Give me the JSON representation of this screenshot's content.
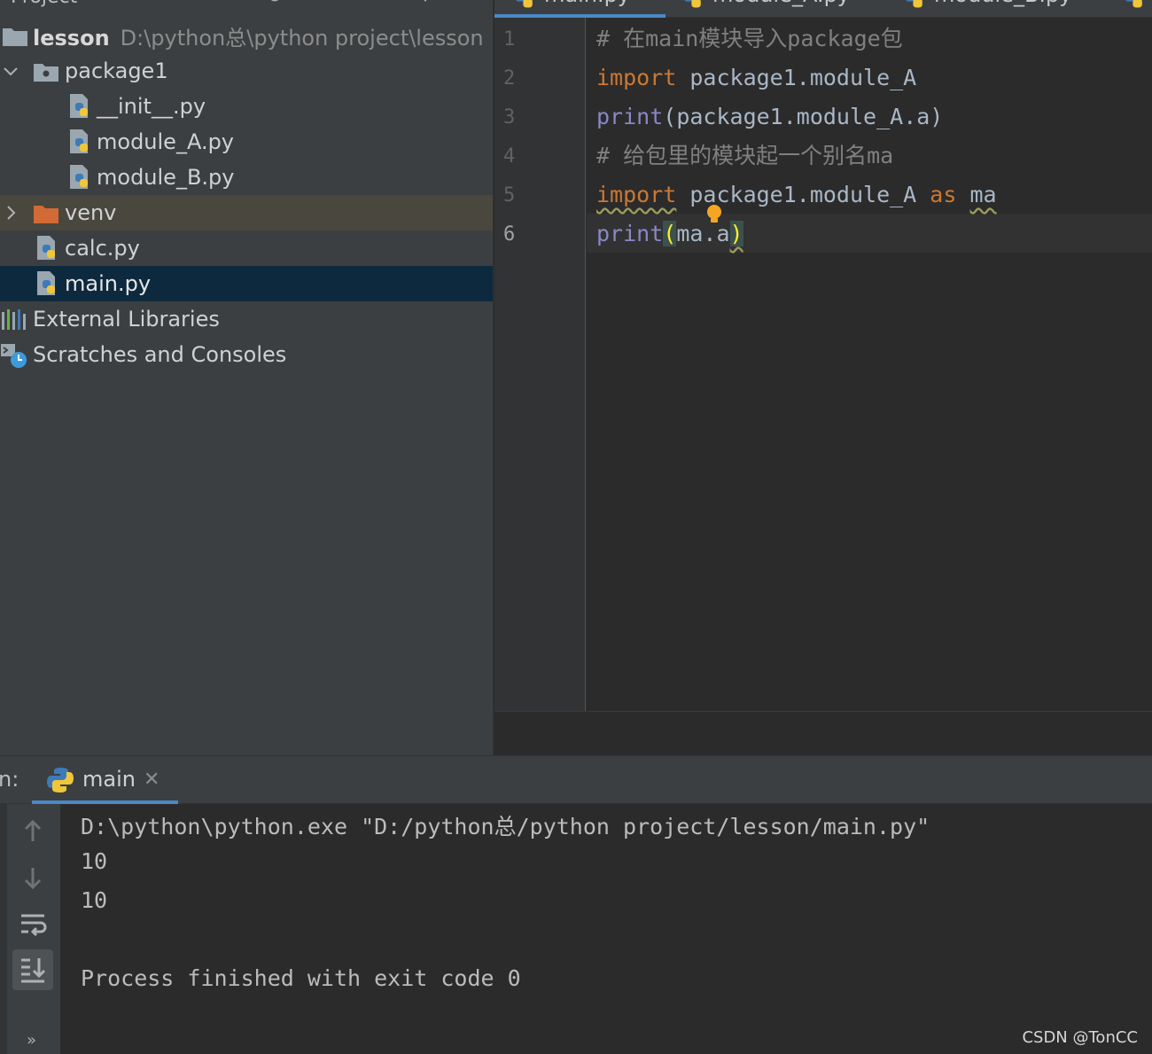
{
  "project_panel": {
    "title": "Project",
    "tree": [
      {
        "label": "lesson",
        "path": "D:\\python总\\python project\\lesson"
      },
      {
        "label": "package1"
      },
      {
        "label": "__init__.py"
      },
      {
        "label": "module_A.py"
      },
      {
        "label": "module_B.py"
      },
      {
        "label": "venv"
      },
      {
        "label": "calc.py"
      },
      {
        "label": "main.py"
      },
      {
        "label": "External Libraries"
      },
      {
        "label": "Scratches and Consoles"
      }
    ]
  },
  "editor": {
    "tabs": [
      {
        "label": "main.py",
        "active": true
      },
      {
        "label": "module_A.py"
      },
      {
        "label": "module_B.py"
      }
    ],
    "line_numbers": [
      "1",
      "2",
      "3",
      "4",
      "5",
      "6"
    ],
    "code": {
      "l1": "# 在main模块导入package包",
      "l2_kw": "import",
      "l2_rest": " package1.module_A",
      "l3_fn": "print",
      "l3_rest": "(package1.module_A.a)",
      "l4": "# 给包里的模块起一个别名ma",
      "l5_kw": "import",
      "l5_mid": " package1.module_A ",
      "l5_as": "as",
      "l5_sp": " ",
      "l5_alias": "ma",
      "l6_fn": "print",
      "l6_open": "(",
      "l6_arg": "ma.a",
      "l6_close": ")"
    },
    "current_line": 6
  },
  "run_panel": {
    "label": "n:",
    "tab_label": "main",
    "output": [
      "D:\\python\\python.exe \"D:/python总/python project/lesson/main.py\"",
      "10",
      "10",
      "",
      "Process finished with exit code 0"
    ]
  },
  "watermark": "CSDN @TonCC",
  "colors": {
    "keyword": "#cc7832",
    "builtin": "#8888c6",
    "comment": "#808080",
    "selection": "#0d293e",
    "accent": "#4a88c7"
  }
}
